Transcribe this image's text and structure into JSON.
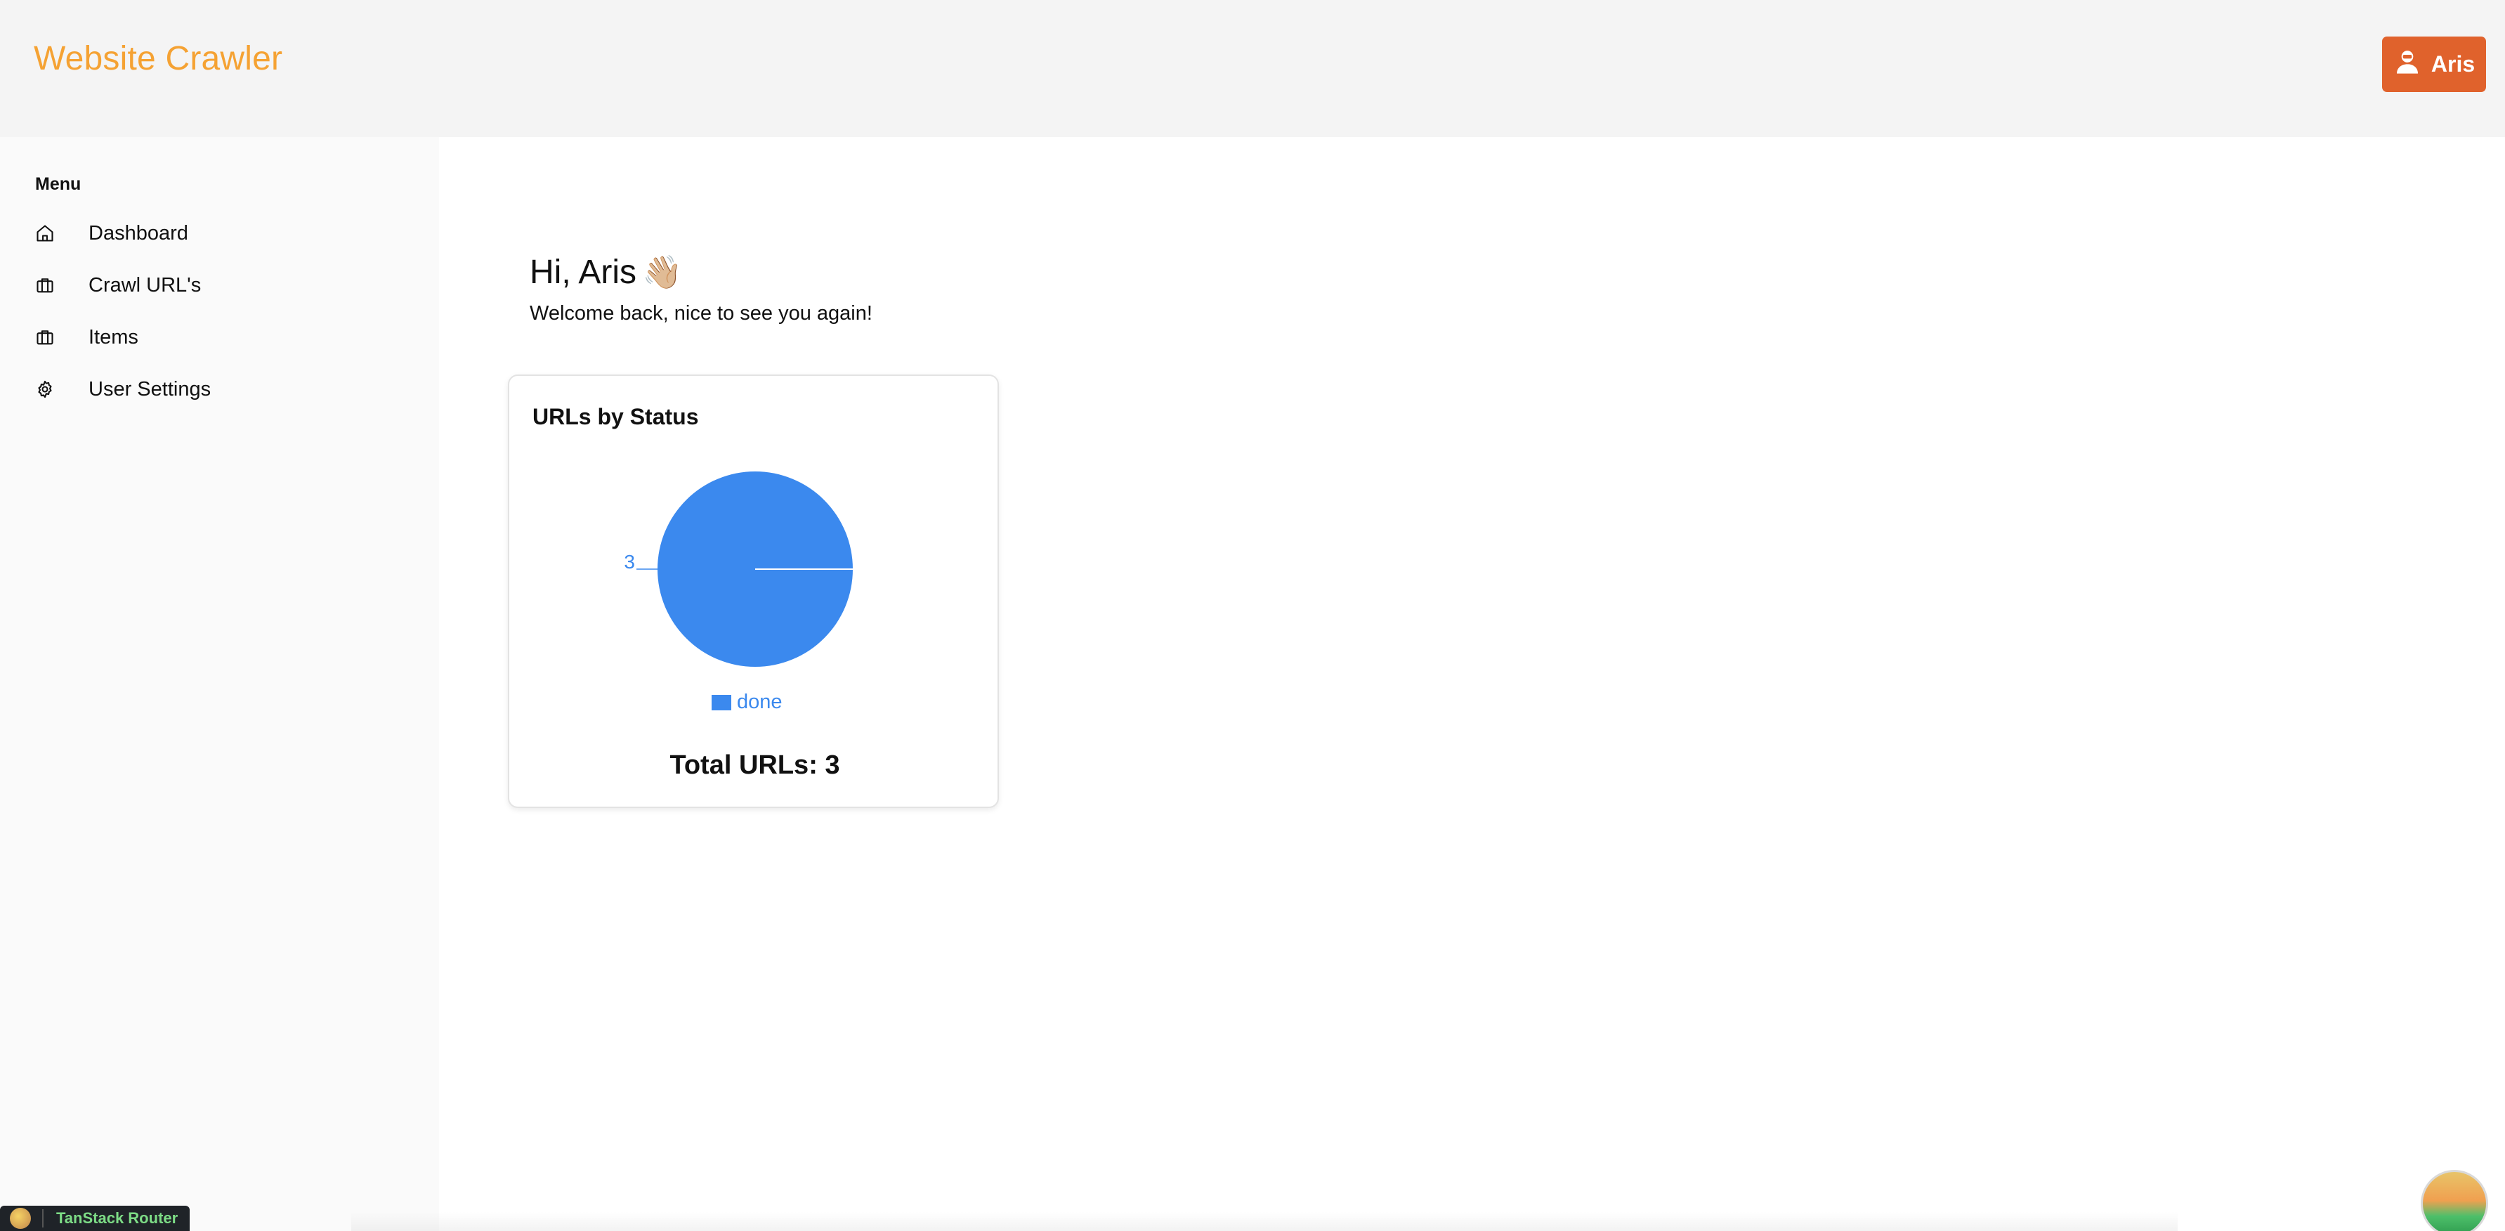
{
  "header": {
    "brand": "Website Crawler",
    "user_button_label": "Aris"
  },
  "sidebar": {
    "menu_title": "Menu",
    "items": [
      {
        "label": "Dashboard",
        "icon": "home-icon"
      },
      {
        "label": "Crawl URL's",
        "icon": "briefcase-icon"
      },
      {
        "label": "Items",
        "icon": "briefcase-icon"
      },
      {
        "label": "User Settings",
        "icon": "gear-icon"
      }
    ]
  },
  "main": {
    "greeting": "Hi, Aris",
    "greeting_emoji": "👋🏼",
    "welcome": "Welcome back, nice to see you again!"
  },
  "card": {
    "title": "URLs by Status",
    "total": "Total URLs: 3"
  },
  "chart_data": {
    "type": "pie",
    "title": "URLs by Status",
    "categories": [
      "done"
    ],
    "values": [
      3
    ],
    "colors": [
      "#3b89ee"
    ],
    "legend": "bottom"
  },
  "devtools": {
    "label": "TanStack Router"
  },
  "colors": {
    "brand": "#f5a233",
    "user_button": "#e0622c",
    "pie": "#3b89ee"
  }
}
